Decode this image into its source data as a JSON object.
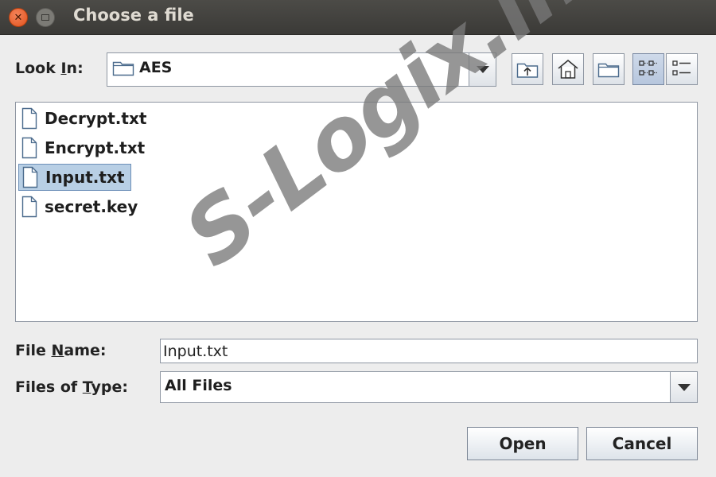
{
  "window": {
    "title": "Choose a file"
  },
  "look_in": {
    "label": "Look In:",
    "label_pre": "Look ",
    "label_mnemonic": "I",
    "label_post": "n:",
    "value": "AES"
  },
  "toolbar": {
    "buttons": [
      {
        "icon": "up-folder-icon"
      },
      {
        "icon": "home-icon"
      },
      {
        "icon": "new-folder-icon"
      },
      {
        "icon": "list-view-icon",
        "active": true
      },
      {
        "icon": "details-view-icon"
      }
    ]
  },
  "files": [
    {
      "name": "Decrypt.txt",
      "selected": false
    },
    {
      "name": "Encrypt.txt",
      "selected": false
    },
    {
      "name": "Input.txt",
      "selected": true
    },
    {
      "name": "secret.key",
      "selected": false
    }
  ],
  "file_name": {
    "label_pre": "File ",
    "label_mnemonic": "N",
    "label_post": "ame:",
    "value": "Input.txt"
  },
  "file_type": {
    "label_pre": "Files of ",
    "label_mnemonic": "T",
    "label_post": "ype:",
    "value": "All Files"
  },
  "buttons": {
    "open": "Open",
    "cancel": "Cancel"
  },
  "watermark": "S-Logix.in",
  "colors": {
    "selection": "#b8cfe5",
    "close_button": "#e0521c",
    "titlebar": "#3b3a37"
  }
}
